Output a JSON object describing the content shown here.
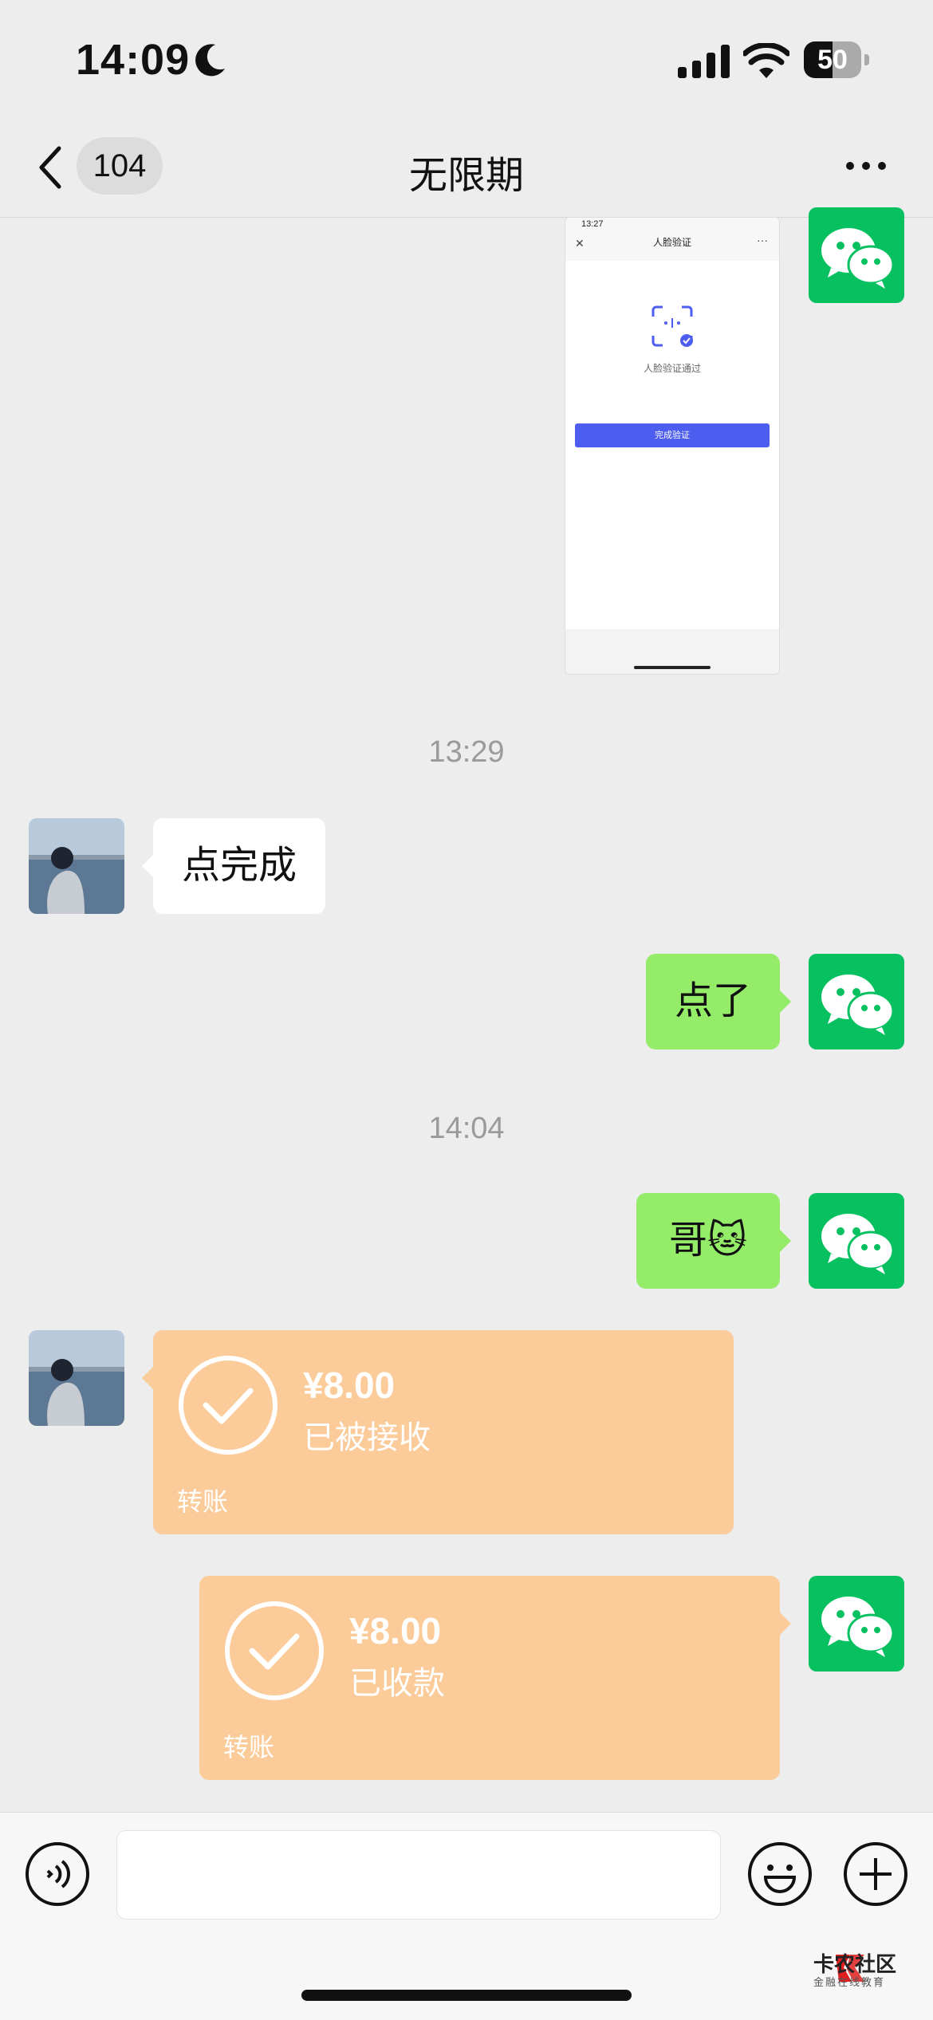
{
  "status_bar": {
    "time": "14:09",
    "battery": "50",
    "battery_level": 0.5
  },
  "nav": {
    "badge": "104",
    "title": "无限期"
  },
  "messages": [
    {
      "type": "image",
      "side": "right",
      "content": {
        "time": "13:27",
        "title": "人脸验证",
        "status": "人脸验证通过",
        "button": "完成验证"
      }
    },
    {
      "type": "timestamp",
      "text": "13:29"
    },
    {
      "type": "text",
      "side": "left",
      "text": "点完成"
    },
    {
      "type": "text",
      "side": "right",
      "text": "点了"
    },
    {
      "type": "timestamp",
      "text": "14:04"
    },
    {
      "type": "text",
      "side": "right",
      "text": "哥🐱"
    },
    {
      "type": "transfer",
      "side": "left",
      "amount": "¥8.00",
      "status": "已被接收",
      "label": "转账"
    },
    {
      "type": "transfer",
      "side": "right",
      "amount": "¥8.00",
      "status": "已收款",
      "label": "转账"
    }
  ],
  "watermark": {
    "name": "卡农社区",
    "tagline": "金融在线教育"
  },
  "colors": {
    "wechat_green": "#07c160",
    "bubble_green": "#95ec69",
    "transfer_orange": "#fbcb9a",
    "background": "#ededed"
  }
}
